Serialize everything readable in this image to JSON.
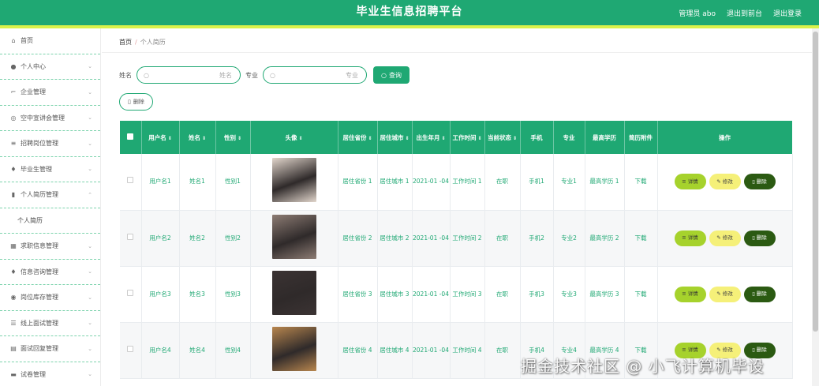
{
  "header": {
    "title": "毕业生信息招聘平台",
    "links": [
      "管理员 abo",
      "退出到前台",
      "退出登录"
    ],
    "bg_color": "#1fa873",
    "accent_color": "#d9f24a"
  },
  "sidebar": {
    "items": [
      {
        "icon": "home-icon",
        "glyph": "⌂",
        "label": "首页",
        "chevron": ""
      },
      {
        "icon": "user-icon",
        "glyph": "●",
        "label": "个人中心",
        "chevron": "⌄"
      },
      {
        "icon": "crop-icon",
        "glyph": "⌐",
        "label": "企业管理",
        "chevron": "⌄"
      },
      {
        "icon": "disc-icon",
        "glyph": "◎",
        "label": "空中宣讲会管理",
        "chevron": "⌄"
      },
      {
        "icon": "sliders-icon",
        "glyph": "≡",
        "label": "招聘岗位管理",
        "chevron": "⌄"
      },
      {
        "icon": "mic-icon",
        "glyph": "♦",
        "label": "毕业生管理",
        "chevron": "⌄"
      },
      {
        "icon": "chart-icon",
        "glyph": "▮",
        "label": "个人简历管理",
        "chevron": "⌃"
      },
      {
        "icon": "",
        "glyph": "",
        "label": "个人简历",
        "chevron": "",
        "sub": true
      },
      {
        "icon": "grid-icon",
        "glyph": "▦",
        "label": "求职信息管理",
        "chevron": "⌄"
      },
      {
        "icon": "mic-icon",
        "glyph": "♦",
        "label": "信息咨询管理",
        "chevron": "⌄"
      },
      {
        "icon": "target-icon",
        "glyph": "◉",
        "label": "岗位库存管理",
        "chevron": "⌄"
      },
      {
        "icon": "list-icon",
        "glyph": "☰",
        "label": "线上面试管理",
        "chevron": "⌄"
      },
      {
        "icon": "panel-icon",
        "glyph": "▤",
        "label": "面试回复管理",
        "chevron": "⌄"
      },
      {
        "icon": "screen-icon",
        "glyph": "▬",
        "label": "试卷管理",
        "chevron": "⌄"
      }
    ]
  },
  "breadcrumb": {
    "home": "首页",
    "sep": "/",
    "current": "个人简历"
  },
  "search": {
    "name_label": "姓名",
    "name_placeholder": "姓名",
    "major_label": "专业",
    "major_placeholder": "专业",
    "search_button": "查询",
    "delete_button": "删除"
  },
  "table": {
    "columns": [
      "",
      "用户名",
      "姓名",
      "性别",
      "头像",
      "居住省份",
      "居住城市",
      "出生年月",
      "工作时间",
      "当前状态",
      "手机",
      "专业",
      "最高学历",
      "简历附件",
      "操作"
    ],
    "sortable": [
      false,
      true,
      true,
      true,
      true,
      true,
      true,
      true,
      true,
      true,
      false,
      false,
      false,
      false,
      false
    ],
    "rows": [
      {
        "username": "用户名1",
        "name": "姓名1",
        "gender": "性别1",
        "avatar_color": "#e2d6cc",
        "province": "居住省份 1",
        "city": "居住城市 1",
        "birth": "2021-01 -04",
        "work_time": "工作时间 1",
        "status": "在职",
        "phone": "手机1",
        "major": "专业1",
        "education": "最高学历 1",
        "attachment": "下载"
      },
      {
        "username": "用户名2",
        "name": "姓名2",
        "gender": "性别2",
        "avatar_color": "#8d7c74",
        "province": "居住省份 2",
        "city": "居住城市 2",
        "birth": "2021-01 -04",
        "work_time": "工作时间 2",
        "status": "在职",
        "phone": "手机2",
        "major": "专业2",
        "education": "最高学历 2",
        "attachment": "下载"
      },
      {
        "username": "用户名3",
        "name": "姓名3",
        "gender": "性别3",
        "avatar_color": "#3b3333",
        "province": "居住省份 3",
        "city": "居住城市 3",
        "birth": "2021-01 -04",
        "work_time": "工作时间 3",
        "status": "在职",
        "phone": "手机3",
        "major": "专业3",
        "education": "最高学历 3",
        "attachment": "下载"
      },
      {
        "username": "用户名4",
        "name": "姓名4",
        "gender": "性别4",
        "avatar_color": "#b8864e",
        "province": "居住省份 4",
        "city": "居住城市 4",
        "birth": "2021-01 -04",
        "work_time": "工作时间 4",
        "status": "在职",
        "phone": "手机4",
        "major": "专业4",
        "education": "最高学历 4",
        "attachment": "下载"
      }
    ],
    "actions": {
      "detail": "详情",
      "edit": "修改",
      "delete": "删除"
    }
  },
  "watermark": "掘金技术社区 @ 小飞计算机毕设"
}
